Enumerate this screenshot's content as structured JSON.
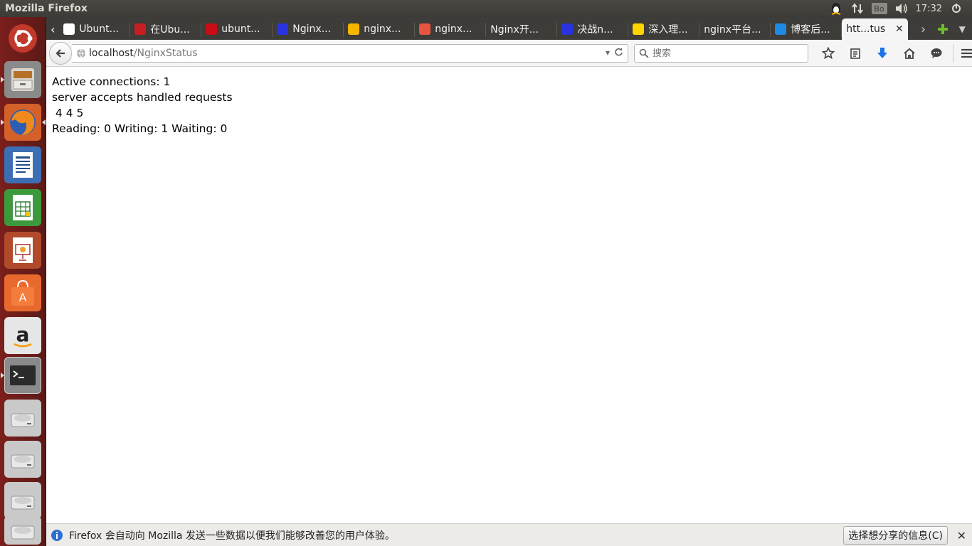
{
  "panel": {
    "window_title": "Mozilla Firefox",
    "keyboard_label": "Bo",
    "clock": "17:32"
  },
  "tabs": [
    {
      "label": "Ubunt...",
      "favicon": "ubuntu-icon",
      "color": "#ffffff"
    },
    {
      "label": "在Ubu...",
      "favicon": "red-diamond-icon",
      "color": "#c71d23"
    },
    {
      "label": "ubunt...",
      "favicon": "csdn-icon",
      "color": "#ca0c16"
    },
    {
      "label": "Nginx...",
      "favicon": "baidu-paw-icon",
      "color": "#2932e1"
    },
    {
      "label": "nginx...",
      "favicon": "bulb-icon",
      "color": "#f7b500"
    },
    {
      "label": "nginx...",
      "favicon": "shield-icon",
      "color": "#e8543f"
    },
    {
      "label": "Nginx开...",
      "favicon": "none",
      "color": "#3d3c38"
    },
    {
      "label": "决战n...",
      "favicon": "baidu-paw-icon",
      "color": "#2932e1"
    },
    {
      "label": "深入理...",
      "favicon": "lightning-icon",
      "color": "#ffd400"
    },
    {
      "label": "nginx平台...",
      "favicon": "none",
      "color": "#3d3c38"
    },
    {
      "label": "博客后...",
      "favicon": "blog-icon",
      "color": "#1e88e5"
    }
  ],
  "active_tab": {
    "label": "htt...tus",
    "close": "✕"
  },
  "urlbar": {
    "host": "localhost",
    "path": "/NginxStatus"
  },
  "searchbar": {
    "placeholder": "搜索"
  },
  "content": {
    "line1": "Active connections: 1",
    "line2": "server accepts handled requests",
    "line3": " 4 4 5",
    "line4": "Reading: 0 Writing: 1 Waiting: 0"
  },
  "notification": {
    "text": "Firefox 会自动向 Mozilla 发送一些数据以便我们能够改善您的用户体验。",
    "button": "选择想分享的信息(C)",
    "close": "✕"
  },
  "colors": {
    "launcher": "#7a1f1c",
    "panel": "#3c3b37",
    "accent_blue": "#1a73e8"
  }
}
